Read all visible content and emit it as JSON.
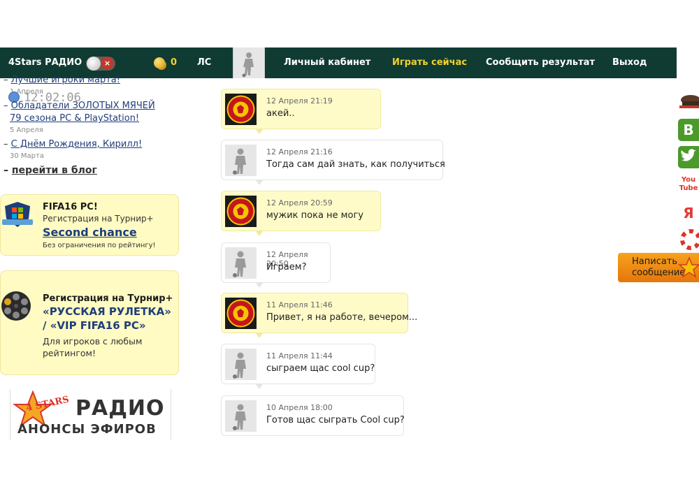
{
  "topbar": {
    "radio_label": "4Stars РАДИО",
    "coins": "0",
    "pm_label": "ЛС",
    "cabinet": "Личный кабинет",
    "play_now": "Играть сейчас",
    "report_result": "Сообщить результат",
    "logout": "Выход"
  },
  "sidebar": {
    "clock": "12:02:06",
    "news": [
      {
        "title": "Лучшие игроки марта!",
        "date": "1 Апреля"
      },
      {
        "title_line1": "Обладатели ЗОЛОТЫХ МЯЧЕЙ",
        "title_line2": "79 сезона PC & PlayStation!",
        "date": "5 Апреля"
      },
      {
        "title": "С Днём Рождения, Кирилл!",
        "date": "30 Марта"
      }
    ],
    "blog_link": "перейти в блог",
    "promo1": {
      "title": "FIFA16 PC!",
      "subtitle": "Регистрация на Турнир+",
      "link": "Second chance",
      "note": "Без ограничения по рейтингу!"
    },
    "promo2": {
      "subtitle": "Регистрация на Турнир+",
      "line1": "«РУССКАЯ РУЛЕТКА»",
      "line2": "/ «VIP FIFA16 PC»",
      "body1": "Для игроков с любым",
      "body2": "рейтингом!"
    },
    "radio_banner": {
      "logo": "4 STARS",
      "line1": "РАДИО",
      "line2": "АНОНСЫ ЭФИРОВ"
    }
  },
  "messages": [
    {
      "sender": "them",
      "date": "12 Апреля 21:19",
      "text": "акей.."
    },
    {
      "sender": "me",
      "date": "12 Апреля 21:16",
      "text": "Тогда сам дай знать, как получиться"
    },
    {
      "sender": "them",
      "date": "12 Апреля 20:59",
      "text": "мужик пока не могу"
    },
    {
      "sender": "me",
      "date": "12 Апреля 20:50",
      "text": "Играем?"
    },
    {
      "sender": "them",
      "date": "11 Апреля 11:46",
      "text": "Привет, я на работе, вечером..."
    },
    {
      "sender": "me",
      "date": "11 Апреля 11:44",
      "text": "сыграем щас cool cup?"
    },
    {
      "sender": "me",
      "date": "10 Апреля 18:00",
      "text": "Готов щас сыграть Cool cup?"
    }
  ],
  "social": {
    "items": [
      "military-cap",
      "vk",
      "twitter",
      "youtube",
      "yandex",
      "lifebuoy",
      "star"
    ],
    "vk_letter": "B",
    "yandex_letter": "Я",
    "youtube_label": "You Tube"
  },
  "write_button": {
    "line1": "Написать",
    "line2": "сообщение"
  },
  "colors": {
    "topbar": "#0f3b33",
    "accent_play": "#f2d22e",
    "bubble_them": "#fffbc9",
    "link": "#1f3e7a"
  }
}
